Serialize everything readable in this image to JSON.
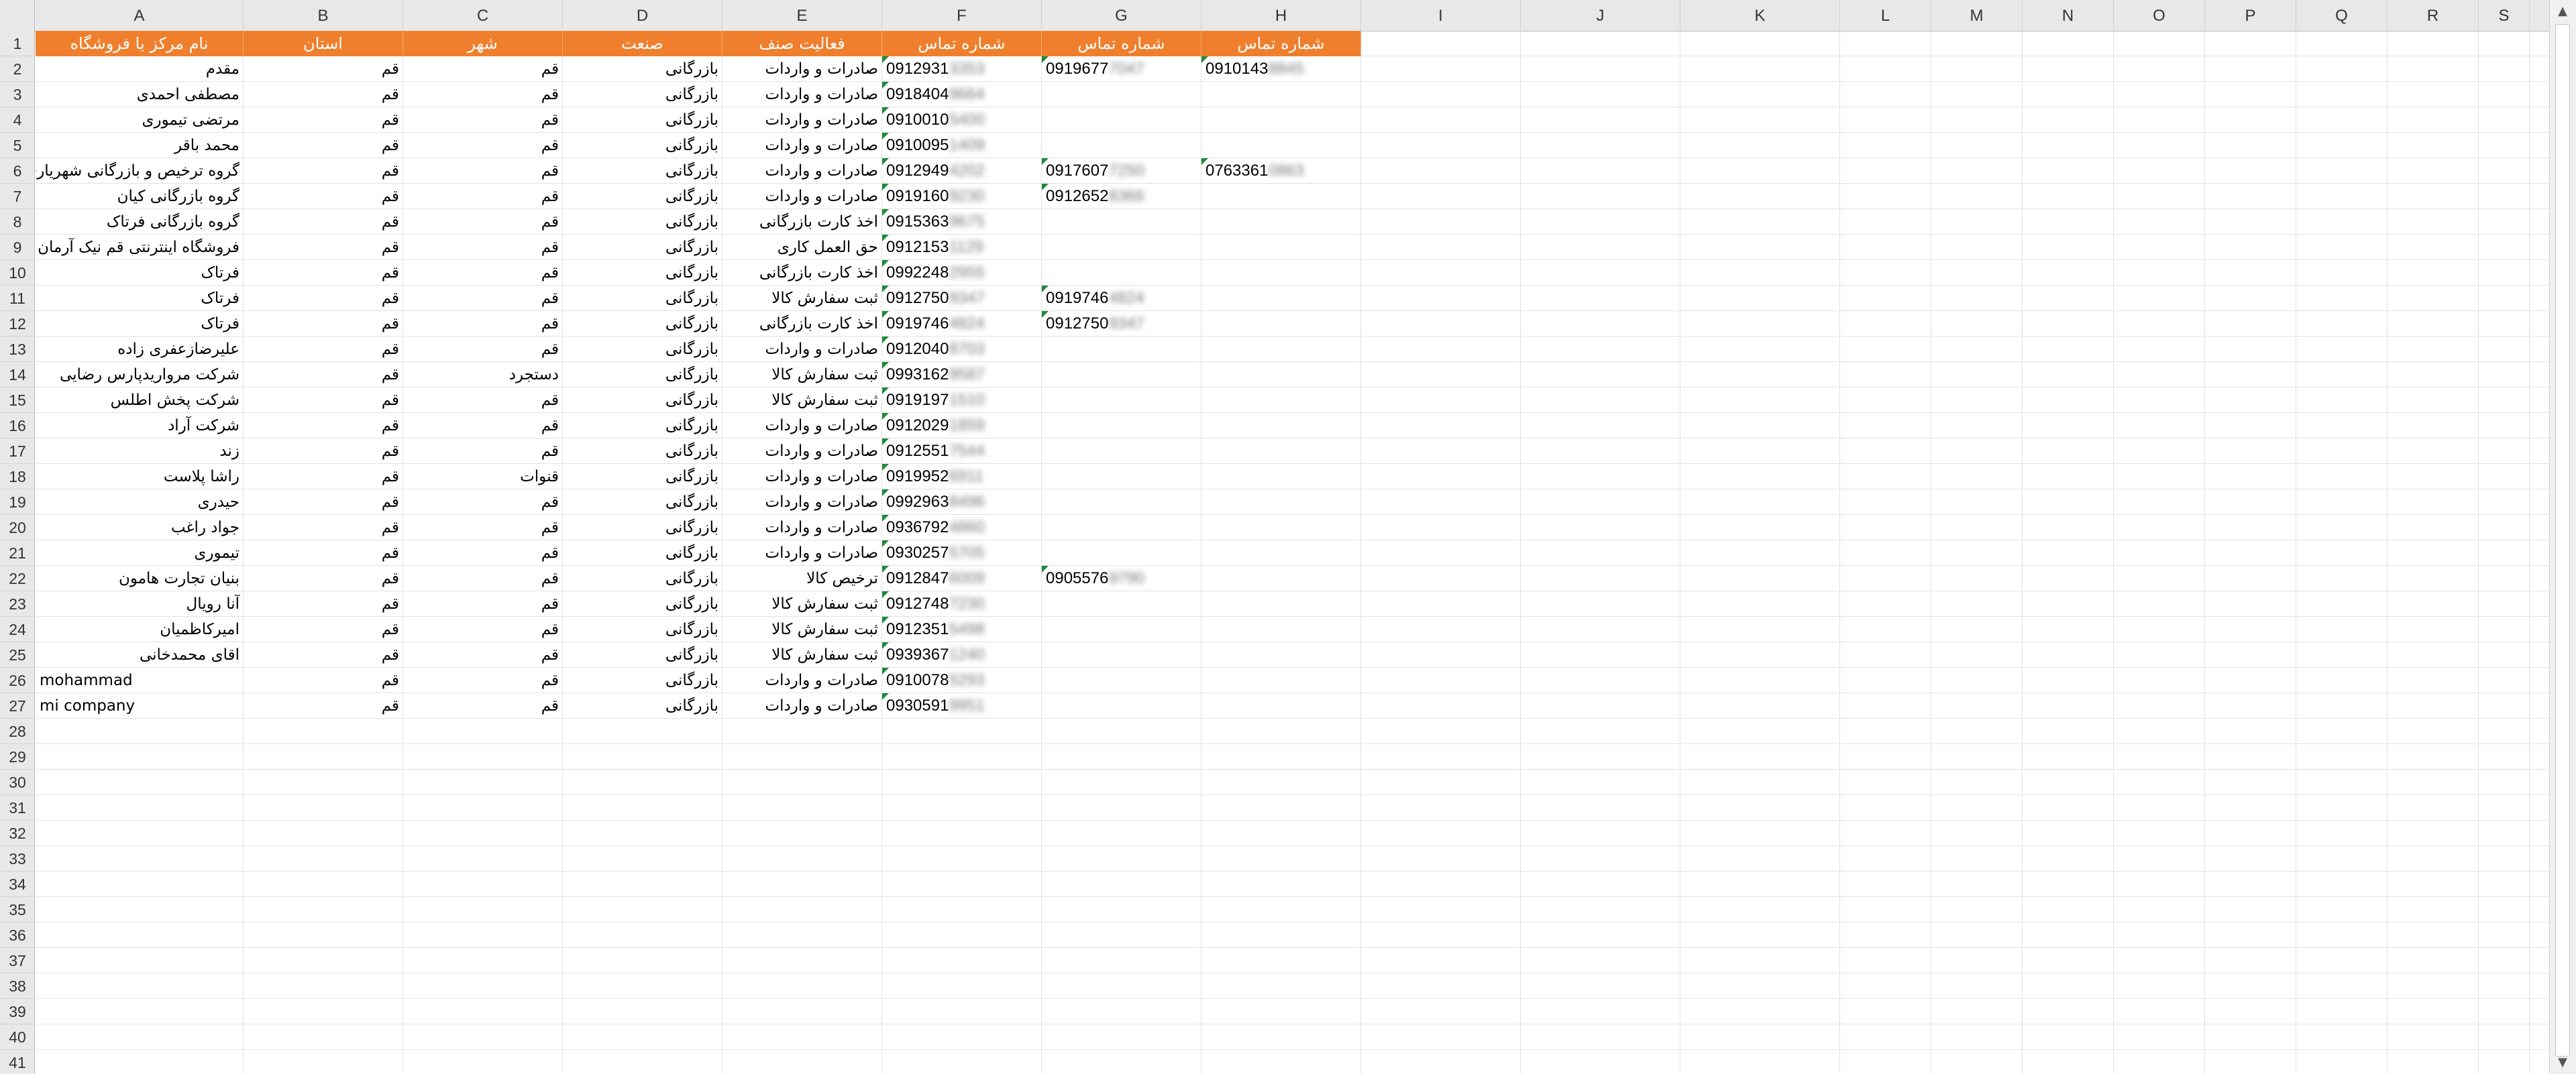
{
  "columns": [
    "A",
    "B",
    "C",
    "D",
    "E",
    "F",
    "G",
    "H",
    "I",
    "J",
    "K",
    "L",
    "M",
    "N",
    "O",
    "P",
    "Q",
    "R",
    "S"
  ],
  "row_numbers": [
    "1",
    "2",
    "3",
    "4",
    "5",
    "6",
    "7",
    "8",
    "9",
    "10",
    "11",
    "12",
    "13",
    "14",
    "15",
    "16",
    "17",
    "18",
    "19",
    "20",
    "21",
    "22",
    "23",
    "24",
    "25",
    "26",
    "27",
    "28",
    "29",
    "30",
    "31",
    "32",
    "33",
    "34",
    "35",
    "36",
    "37",
    "38",
    "39",
    "40",
    "41"
  ],
  "headers": [
    "نام مرکز یا فروشگاه",
    "استان",
    "شهر",
    "صنعت",
    "فعالیت صنف",
    "شماره تماس",
    "شماره تماس",
    "شماره تماس"
  ],
  "rows": [
    {
      "name": "مقدم",
      "province": "قم",
      "city": "قم",
      "industry": "بازرگانی",
      "activity": "صادرات و واردات",
      "phone1": [
        "0912931",
        "3353"
      ],
      "phone2": [
        "0919677",
        "7047"
      ],
      "phone3": [
        "0910143",
        "8845"
      ]
    },
    {
      "name": "مصطفی احمدی",
      "province": "قم",
      "city": "قم",
      "industry": "بازرگانی",
      "activity": "صادرات و واردات",
      "phone1": [
        "0918404",
        "9664"
      ],
      "phone2": null,
      "phone3": null
    },
    {
      "name": "مرتضی تیموری",
      "province": "قم",
      "city": "قم",
      "industry": "بازرگانی",
      "activity": "صادرات و واردات",
      "phone1": [
        "0910010",
        "5400"
      ],
      "phone2": null,
      "phone3": null
    },
    {
      "name": "محمد باقر",
      "province": "قم",
      "city": "قم",
      "industry": "بازرگانی",
      "activity": "صادرات و واردات",
      "phone1": [
        "0910095",
        "1409"
      ],
      "phone2": null,
      "phone3": null
    },
    {
      "name": "گروه ترخیص و بازرگانی شهریاری",
      "province": "قم",
      "city": "قم",
      "industry": "بازرگانی",
      "activity": "صادرات و واردات",
      "phone1": [
        "0912949",
        "4202"
      ],
      "phone2": [
        "0917607",
        "7250"
      ],
      "phone3": [
        "0763361",
        "0863"
      ]
    },
    {
      "name": "گروه بازرگانی کیان",
      "province": "قم",
      "city": "قم",
      "industry": "بازرگانی",
      "activity": "صادرات و واردات",
      "phone1": [
        "0919160",
        "9230"
      ],
      "phone2": [
        "0912652",
        "8366"
      ],
      "phone3": null
    },
    {
      "name": "گروه بازرگانی فرتاک",
      "province": "قم",
      "city": "قم",
      "industry": "بازرگانی",
      "activity": "اخذ کارت بازرگانی",
      "phone1": [
        "0915363",
        "9675"
      ],
      "phone2": null,
      "phone3": null
    },
    {
      "name": "فروشگاه اینترنتی قم نیک آرمان",
      "province": "قم",
      "city": "قم",
      "industry": "بازرگانی",
      "activity": "حق العمل کاری",
      "phone1": [
        "0912153",
        "1129"
      ],
      "phone2": null,
      "phone3": null
    },
    {
      "name": "فرتاک",
      "province": "قم",
      "city": "قم",
      "industry": "بازرگانی",
      "activity": "اخذ کارت بازرگانی",
      "phone1": [
        "0992248",
        "2955"
      ],
      "phone2": null,
      "phone3": null
    },
    {
      "name": "فرتاک",
      "province": "قم",
      "city": "قم",
      "industry": "بازرگانی",
      "activity": "ثبت سفارش کالا",
      "phone1": [
        "0912750",
        "9347"
      ],
      "phone2": [
        "0919746",
        "4824"
      ],
      "phone3": null
    },
    {
      "name": "فرتاک",
      "province": "قم",
      "city": "قم",
      "industry": "بازرگانی",
      "activity": "اخذ کارت بازرگانی",
      "phone1": [
        "0919746",
        "4824"
      ],
      "phone2": [
        "0912750",
        "9347"
      ],
      "phone3": null
    },
    {
      "name": "علیرضازعفری زاده",
      "province": "قم",
      "city": "قم",
      "industry": "بازرگانی",
      "activity": "صادرات و واردات",
      "phone1": [
        "0912040",
        "8703"
      ],
      "phone2": null,
      "phone3": null
    },
    {
      "name": "شرکت مرواریدپارس رضایی",
      "province": "قم",
      "city": "دستجرد",
      "industry": "بازرگانی",
      "activity": "ثبت سفارش کالا",
      "phone1": [
        "0993162",
        "9587"
      ],
      "phone2": null,
      "phone3": null
    },
    {
      "name": "شرکت پخش اطلس",
      "province": "قم",
      "city": "قم",
      "industry": "بازرگانی",
      "activity": "ثبت سفارش کالا",
      "phone1": [
        "0919197",
        "1510"
      ],
      "phone2": null,
      "phone3": null
    },
    {
      "name": "شرکت آراد",
      "province": "قم",
      "city": "قم",
      "industry": "بازرگانی",
      "activity": "صادرات و واردات",
      "phone1": [
        "0912029",
        "1859"
      ],
      "phone2": null,
      "phone3": null
    },
    {
      "name": "زند",
      "province": "قم",
      "city": "قم",
      "industry": "بازرگانی",
      "activity": "صادرات و واردات",
      "phone1": [
        "0912551",
        "7544"
      ],
      "phone2": null,
      "phone3": null
    },
    {
      "name": "راشا پلاست",
      "province": "قم",
      "city": "قنوات",
      "industry": "بازرگانی",
      "activity": "صادرات و واردات",
      "phone1": [
        "0919952",
        "6911"
      ],
      "phone2": null,
      "phone3": null
    },
    {
      "name": "حیدری",
      "province": "قم",
      "city": "قم",
      "industry": "بازرگانی",
      "activity": "صادرات و واردات",
      "phone1": [
        "0992963",
        "8496"
      ],
      "phone2": null,
      "phone3": null
    },
    {
      "name": "جواد راغب",
      "province": "قم",
      "city": "قم",
      "industry": "بازرگانی",
      "activity": "صادرات و واردات",
      "phone1": [
        "0936792",
        "4860"
      ],
      "phone2": null,
      "phone3": null
    },
    {
      "name": "تیموری",
      "province": "قم",
      "city": "قم",
      "industry": "بازرگانی",
      "activity": "صادرات و واردات",
      "phone1": [
        "0930257",
        "5705"
      ],
      "phone2": null,
      "phone3": null
    },
    {
      "name": "بنیان تجارت هامون",
      "province": "قم",
      "city": "قم",
      "industry": "بازرگانی",
      "activity": "ترخیص کالا",
      "phone1": [
        "0912847",
        "6009"
      ],
      "phone2": [
        "0905576",
        "9790"
      ],
      "phone3": null
    },
    {
      "name": "آنا رویال",
      "province": "قم",
      "city": "قم",
      "industry": "بازرگانی",
      "activity": "ثبت سفارش کالا",
      "phone1": [
        "0912748",
        "7230"
      ],
      "phone2": null,
      "phone3": null
    },
    {
      "name": "امیرکاظمیان",
      "province": "قم",
      "city": "قم",
      "industry": "بازرگانی",
      "activity": "ثبت سفارش کالا",
      "phone1": [
        "0912351",
        "5498"
      ],
      "phone2": null,
      "phone3": null
    },
    {
      "name": "اقای محمدخانی",
      "province": "قم",
      "city": "قم",
      "industry": "بازرگانی",
      "activity": "ثبت سفارش کالا",
      "phone1": [
        "0939367",
        "1240"
      ],
      "phone2": null,
      "phone3": null
    },
    {
      "name": "mohammad",
      "province": "قم",
      "city": "قم",
      "industry": "بازرگانی",
      "activity": "صادرات و واردات",
      "phone1": [
        "0910078",
        "5293"
      ],
      "phone2": null,
      "phone3": null
    },
    {
      "name": "mi company",
      "province": "قم",
      "city": "قم",
      "industry": "بازرگانی",
      "activity": "صادرات و واردات",
      "phone1": [
        "0930591",
        "9951"
      ],
      "phone2": null,
      "phone3": null
    }
  ],
  "scrollbar": {
    "up_arrow": "▲",
    "down_arrow": "▼"
  },
  "colors": {
    "header_fill": "#f07f2d",
    "header_text": "#ffffff",
    "error_flag": "#1e8a3a",
    "gridline": "#e2e2e2"
  }
}
